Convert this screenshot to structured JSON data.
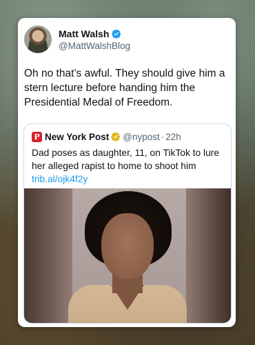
{
  "tweet": {
    "author_name": "Matt Walsh",
    "author_handle": "@MattWalshBlog",
    "text": "Oh no that’s awful. They should give him a stern lecture before handing him the Presidential Medal of Freedom.",
    "verified_color": "#1d9bf0"
  },
  "quote": {
    "logo_glyph": "P",
    "source_name": "New York Post",
    "source_handle": "@nypost",
    "separator": "·",
    "time": "22h",
    "text": "Dad poses as daughter, 11, on TikTok to lure her alleged rapist to home to shoot him",
    "link": "trib.al/ojk4f2y",
    "logo_color": "#d6212a",
    "verified_color": "#e2b719"
  }
}
